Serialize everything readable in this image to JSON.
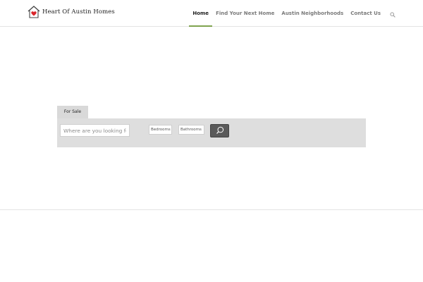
{
  "header": {
    "logo_text": "Heart Of Austin Homes",
    "nav": [
      {
        "label": "Home",
        "active": true
      },
      {
        "label": "Find Your Next Home",
        "active": false
      },
      {
        "label": "Austin Neighborhoods",
        "active": false
      },
      {
        "label": "Contact Us",
        "active": false
      }
    ],
    "search_icon": "search-icon",
    "accent_color": "#7fa34f"
  },
  "search_panel": {
    "tab_label": "For Sale",
    "location_placeholder": "Where are you looking for?",
    "bedrooms_label": "Bedrooms",
    "bathrooms_label": "Bathrooms",
    "submit_icon": "search-icon"
  }
}
